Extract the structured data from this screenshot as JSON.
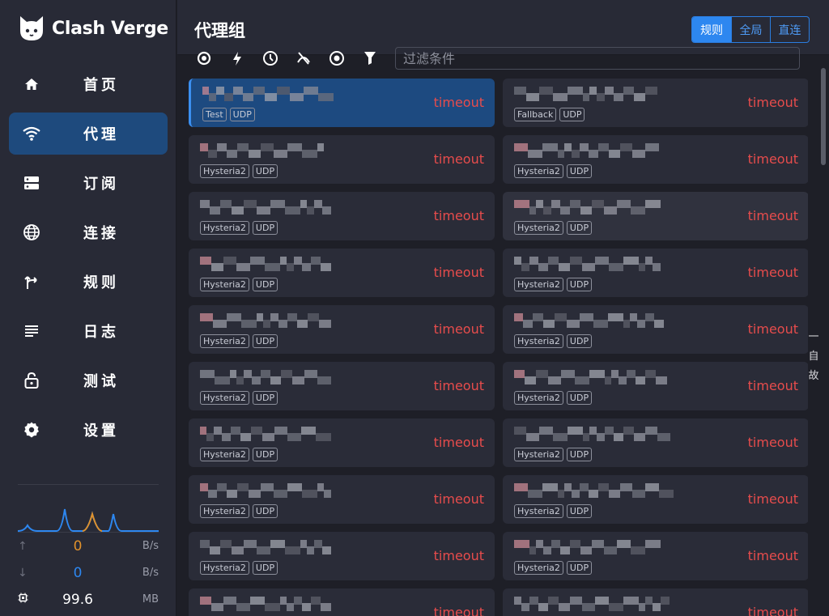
{
  "app": {
    "name": "Clash Verge"
  },
  "sidebar": {
    "items": [
      {
        "label": "首页",
        "icon": "home-icon",
        "active": false
      },
      {
        "label": "代理",
        "icon": "wifi-icon",
        "active": true
      },
      {
        "label": "订阅",
        "icon": "storage-icon",
        "active": false
      },
      {
        "label": "连接",
        "icon": "globe-icon",
        "active": false
      },
      {
        "label": "规则",
        "icon": "fork-icon",
        "active": false
      },
      {
        "label": "日志",
        "icon": "list-icon",
        "active": false
      },
      {
        "label": "测试",
        "icon": "lock-icon",
        "active": false
      },
      {
        "label": "设置",
        "icon": "gear-icon",
        "active": false
      }
    ],
    "traffic": {
      "up_value": "0",
      "up_unit": "B/s",
      "down_value": "0",
      "down_unit": "B/s",
      "mem_value": "99.6",
      "mem_unit": "MB"
    }
  },
  "header": {
    "title": "代理组",
    "modes": [
      {
        "label": "规则",
        "active": true
      },
      {
        "label": "全局",
        "active": false
      },
      {
        "label": "直连",
        "active": false
      }
    ]
  },
  "toolbar": {
    "filter_placeholder": "过滤条件"
  },
  "proxies": [
    {
      "tags": [
        "Test",
        "UDP"
      ],
      "delay": "timeout"
    },
    {
      "tags": [
        "Fallback",
        "UDP"
      ],
      "delay": "timeout"
    },
    {
      "tags": [
        "Hysteria2",
        "UDP"
      ],
      "delay": "timeout"
    },
    {
      "tags": [
        "Hysteria2",
        "UDP"
      ],
      "delay": "timeout"
    },
    {
      "tags": [
        "Hysteria2",
        "UDP"
      ],
      "delay": "timeout"
    },
    {
      "tags": [
        "Hysteria2",
        "UDP"
      ],
      "delay": "timeout"
    },
    {
      "tags": [
        "Hysteria2",
        "UDP"
      ],
      "delay": "timeout"
    },
    {
      "tags": [
        "Hysteria2",
        "UDP"
      ],
      "delay": "timeout"
    },
    {
      "tags": [
        "Hysteria2",
        "UDP"
      ],
      "delay": "timeout"
    },
    {
      "tags": [
        "Hysteria2",
        "UDP"
      ],
      "delay": "timeout"
    },
    {
      "tags": [
        "Hysteria2",
        "UDP"
      ],
      "delay": "timeout"
    },
    {
      "tags": [
        "Hysteria2",
        "UDP"
      ],
      "delay": "timeout"
    },
    {
      "tags": [
        "Hysteria2",
        "UDP"
      ],
      "delay": "timeout"
    },
    {
      "tags": [
        "Hysteria2",
        "UDP"
      ],
      "delay": "timeout"
    },
    {
      "tags": [
        "Hysteria2",
        "UDP"
      ],
      "delay": "timeout"
    },
    {
      "tags": [
        "Hysteria2",
        "UDP"
      ],
      "delay": "timeout"
    },
    {
      "tags": [
        "Hysteria2",
        "UDP"
      ],
      "delay": "timeout"
    },
    {
      "tags": [
        "Hysteria2",
        "UDP"
      ],
      "delay": "timeout"
    },
    {
      "tags": [],
      "delay": "timeout"
    },
    {
      "tags": [],
      "delay": "timeout"
    }
  ],
  "side_hint": [
    "一",
    "自",
    "故"
  ],
  "colors": {
    "accent": "#2d87f0",
    "timeout": "#e74c4c",
    "selected": "#1d4a80",
    "upload": "#e0912b",
    "download": "#2d87f0"
  }
}
